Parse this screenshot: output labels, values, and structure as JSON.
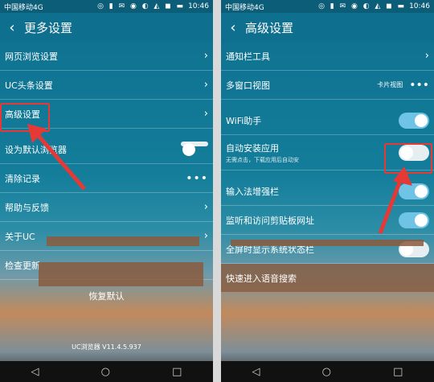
{
  "left": {
    "status": {
      "carrier": "中国移动4G",
      "time": "10:46"
    },
    "header": {
      "title": "更多设置"
    },
    "rows": [
      {
        "label": "网页浏览设置",
        "kind": "chevron"
      },
      {
        "label": "UC头条设置",
        "kind": "chevron"
      },
      {
        "label": "高级设置",
        "kind": "chevron"
      },
      {
        "label": "设为默认浏览器",
        "kind": "toggle-partial"
      },
      {
        "label": "清除记录",
        "kind": "dots"
      },
      {
        "label": "帮助与反馈",
        "kind": "chevron"
      },
      {
        "label": "关于UC",
        "kind": "chevron"
      },
      {
        "label": "检查更新",
        "kind": "none"
      }
    ],
    "reset_label": "恢复默认",
    "version": "UC浏览器 V11.4.5.937"
  },
  "right": {
    "status": {
      "carrier": "中国移动4G",
      "time": "10:46"
    },
    "header": {
      "title": "高级设置"
    },
    "rows": [
      {
        "label": "通知栏工具",
        "kind": "chevron"
      },
      {
        "label": "多窗口视图",
        "value": "卡片视图",
        "kind": "dots"
      },
      {
        "label": "WiFi助手",
        "kind": "toggle-on"
      },
      {
        "label": "自动安装应用",
        "sub": "无需点击，下载应用后自动安",
        "kind": "toggle-highlight"
      },
      {
        "label": "输入法增强栏",
        "kind": "toggle-on"
      },
      {
        "label": "监听和访问剪贴板网址",
        "kind": "toggle-on"
      },
      {
        "label": "全屏时显示系统状态栏",
        "kind": "toggle-off"
      },
      {
        "label": "快速进入语音搜索",
        "kind": "none"
      }
    ]
  },
  "colors": {
    "highlight": "#e53935",
    "accent": "#6fc4e6"
  }
}
